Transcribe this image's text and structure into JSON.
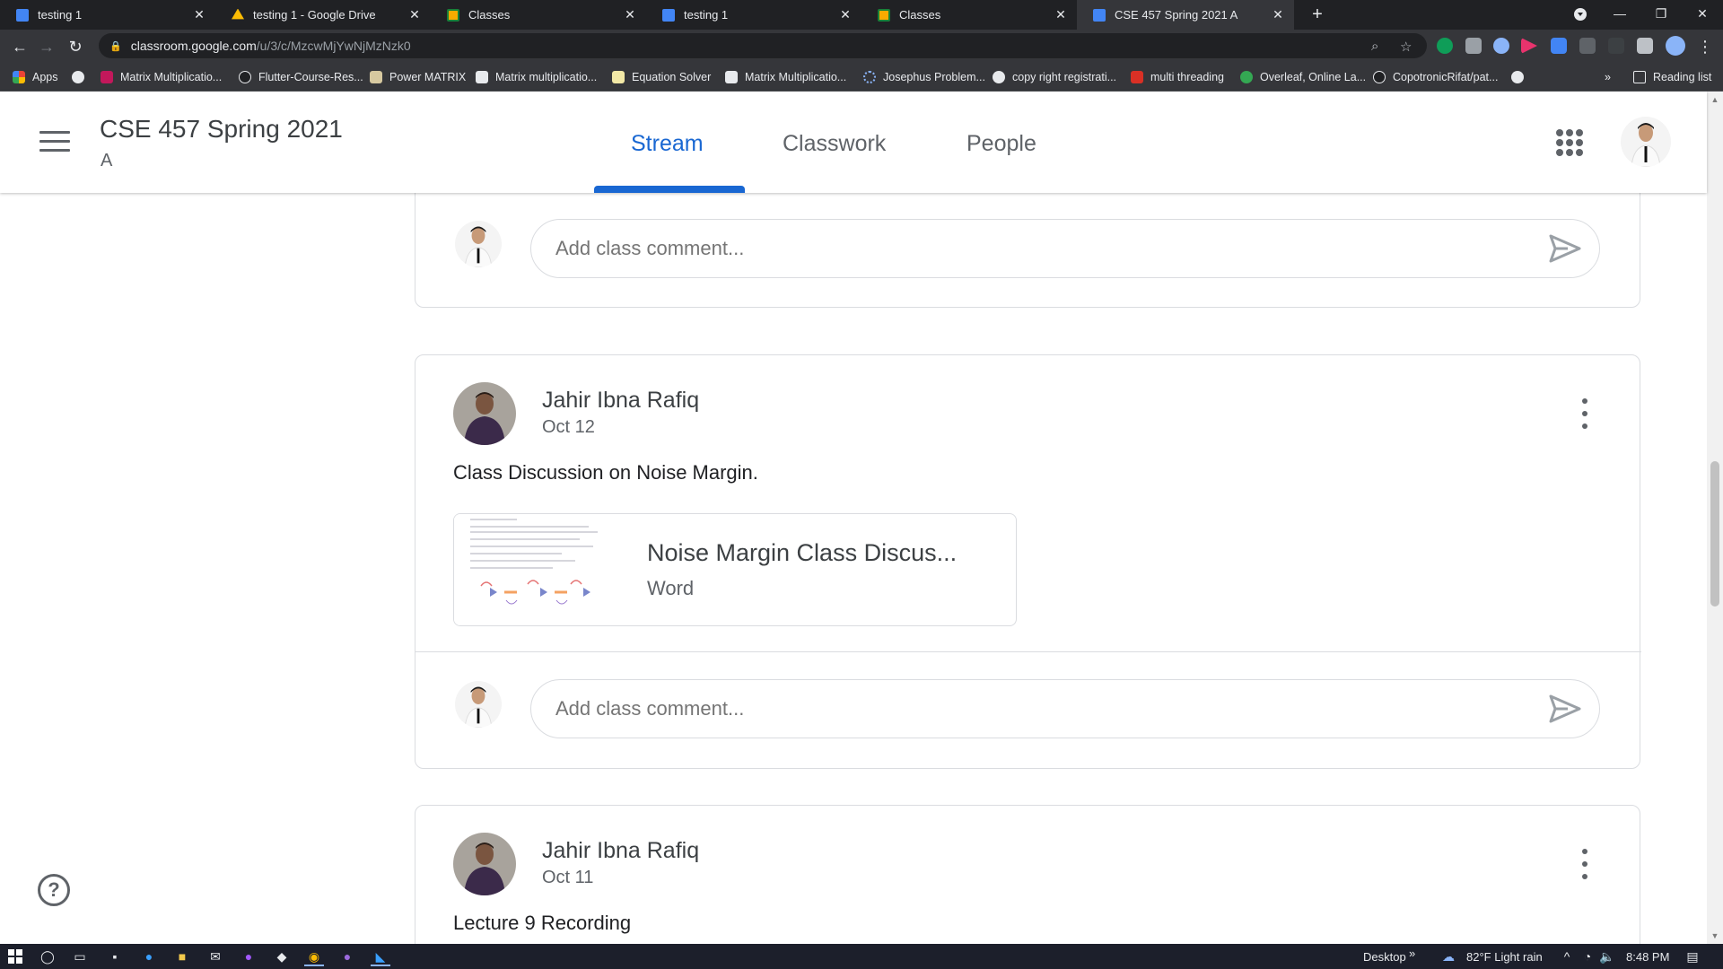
{
  "browser": {
    "tabs": [
      {
        "title": "testing 1",
        "color": "#4285f4"
      },
      {
        "title": "testing 1 - Google Drive",
        "color": "#fbbc04"
      },
      {
        "title": "Classes",
        "color": "#f9ab00"
      },
      {
        "title": "testing 1",
        "color": "#4285f4"
      },
      {
        "title": "Classes",
        "color": "#f9ab00"
      },
      {
        "title": "CSE 457 Spring 2021 A",
        "color": "#4285f4"
      }
    ],
    "url_host": "classroom.google.com",
    "url_path": "/u/3/c/MzcwMjYwNjMzNzk0",
    "bookmarks": [
      "Apps",
      "Matrix Multiplicatio...",
      "Flutter-Course-Res...",
      "Power MATRIX",
      "Matrix multiplicatio...",
      "Equation Solver",
      "Matrix Multiplicatio...",
      "Josephus Problem...",
      "copy right registrati...",
      "multi threading",
      "Overleaf, Online La...",
      "CopotronicRifat/pat..."
    ],
    "reading_list": "Reading list"
  },
  "header": {
    "class_title": "CSE 457 Spring 2021",
    "section": "A",
    "tabs": [
      "Stream",
      "Classwork",
      "People"
    ],
    "accent": "#1967d2"
  },
  "stream": {
    "comment_placeholder": "Add class comment...",
    "posts": [
      {
        "author": "Jahir Ibna Rafiq",
        "date": "Oct 12",
        "text": "Class Discussion on Noise Margin.",
        "attachment": {
          "title": "Noise Margin Class Discus...",
          "type": "Word"
        }
      },
      {
        "author": "Jahir Ibna Rafiq",
        "date": "Oct 11",
        "text": "Lecture 9 Recording"
      }
    ]
  },
  "taskbar": {
    "desktop": "Desktop",
    "weather": "82°F  Light rain",
    "time": "8:48 PM"
  }
}
